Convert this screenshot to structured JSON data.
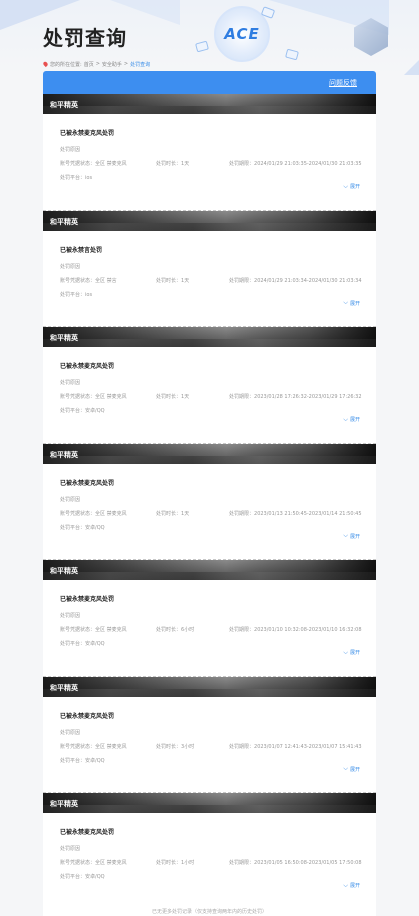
{
  "header": {
    "title": "处罚查询",
    "logo_text": "ACE",
    "breadcrumb": {
      "prefix": "您的所在位置:",
      "items": [
        "首页",
        "安全助手",
        "处罚查询"
      ]
    }
  },
  "toolbar": {
    "feedback_label": "问题反馈"
  },
  "labels": {
    "account_prefix": "账号凭据状态：",
    "duration_prefix": "处罚时长：",
    "period_prefix": "处罚期限：",
    "platform_prefix": "处罚平台：",
    "expand": "展开"
  },
  "records": [
    {
      "game": "和平精英",
      "title": "已被永禁麦克风处罚",
      "type": "处罚原因",
      "account": "全区 禁麦克风",
      "duration": "1天",
      "period": "2024/01/29 21:03:35-2024/01/30 21:03:35",
      "platform": "ios"
    },
    {
      "game": "和平精英",
      "title": "已被永禁言处罚",
      "type": "处罚原因",
      "account": "全区 禁言",
      "duration": "1天",
      "period": "2024/01/29 21:03:34-2024/01/30 21:03:34",
      "platform": "ios"
    },
    {
      "game": "和平精英",
      "title": "已被永禁麦克风处罚",
      "type": "处罚原因",
      "account": "全区 禁麦克风",
      "duration": "1天",
      "period": "2023/01/28 17:26:32-2023/01/29 17:26:32",
      "platform": "安卓/QQ"
    },
    {
      "game": "和平精英",
      "title": "已被永禁麦克风处罚",
      "type": "处罚原因",
      "account": "全区 禁麦克风",
      "duration": "1天",
      "period": "2023/01/13 21:50:45-2023/01/14 21:50:45",
      "platform": "安卓/QQ"
    },
    {
      "game": "和平精英",
      "title": "已被永禁麦克风处罚",
      "type": "处罚原因",
      "account": "全区 禁麦克风",
      "duration": "6小时",
      "period": "2023/01/10 10:32:08-2023/01/10 16:32:08",
      "platform": "安卓/QQ"
    },
    {
      "game": "和平精英",
      "title": "已被永禁麦克风处罚",
      "type": "处罚原因",
      "account": "全区 禁麦克风",
      "duration": "3小时",
      "period": "2023/01/07 12:41:43-2023/01/07 15:41:43",
      "platform": "安卓/QQ"
    },
    {
      "game": "和平精英",
      "title": "已被永禁麦克风处罚",
      "type": "处罚原因",
      "account": "全区 禁麦克风",
      "duration": "1小时",
      "period": "2023/01/05 16:50:08-2023/01/05 17:50:08",
      "platform": "安卓/QQ"
    }
  ],
  "footer": {
    "note": "已无更多处罚记录（仅支持查询两年内的历史处罚）"
  }
}
